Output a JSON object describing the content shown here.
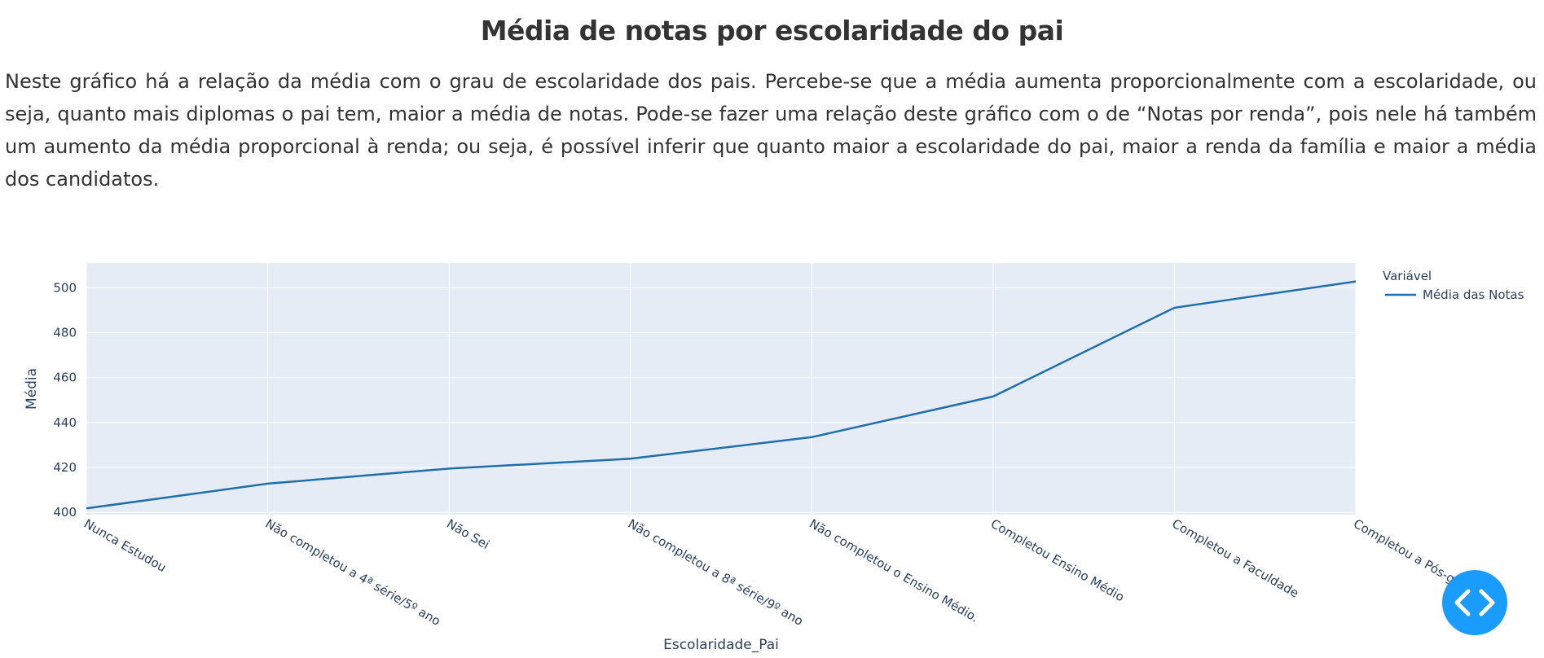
{
  "page": {
    "title": "Média de notas por escolaridade do pai",
    "description": "Neste gráfico há a relação da média com o grau de escolaridade dos pais. Percebe-se que a média aumenta proporcionalmente com a escolaridade, ou seja, quanto mais diplomas o pai tem, maior a média de notas. Pode-se fazer uma relação deste gráfico com o de “Notas por renda”, pois nele há também um aumento da média proporcional à renda; ou seja, é possível inferir que quanto maior a escolaridade do pai, maior a renda da família e maior a média dos candidatos."
  },
  "chart_data": {
    "type": "line",
    "xlabel": "Escolaridade_Pai",
    "ylabel": "Média",
    "categories": [
      "Nunca Estudou",
      "Não completou a 4ª série/5º ano",
      "Não Sei",
      "Não completou a 8ª série/9º ano",
      "Não completou o Ensino Médio.",
      "Completou Ensino Médio",
      "Completou a Faculdade",
      "Completou a Pós-graduação"
    ],
    "series": [
      {
        "name": "Média das Notas",
        "values": [
          401.8,
          412.8,
          419.5,
          423.9,
          433.5,
          451.6,
          491.1,
          502.8
        ]
      }
    ],
    "ylim": [
      399,
      511
    ],
    "yticks": [
      400,
      420,
      440,
      460,
      480,
      500
    ],
    "grid": true,
    "legend": {
      "title": "Variável",
      "position": "top-right"
    },
    "colors": {
      "line": "#1f6fad",
      "plot_bg": "#e5ecf6",
      "grid": "#ffffff",
      "tick_text": "#2a3f5f"
    }
  },
  "ui": {
    "code_button_icon": "code-brackets-icon"
  }
}
